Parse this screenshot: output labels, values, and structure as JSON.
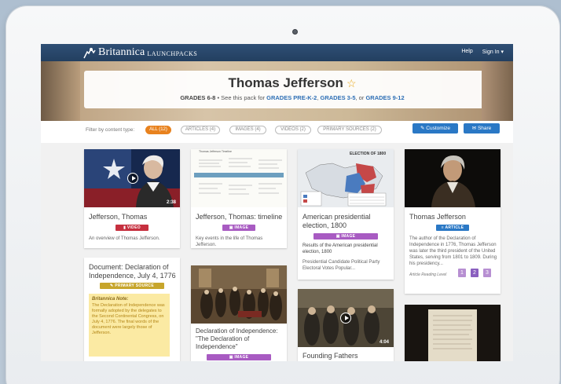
{
  "nav": {
    "brand": "Britannica",
    "brand_sub": "LAUNCHPACKS",
    "help": "Help",
    "sign_in": "Sign In ▾"
  },
  "hero": {
    "title": "Thomas Jefferson",
    "grades_label": "GRADES 6-8",
    "see_text": "• See this pack for",
    "grade_links": [
      "GRADES PRE-K-2",
      "GRADES 3-5",
      "GRADES 9-12"
    ],
    "sep_comma": ",",
    "sep_or": ", or"
  },
  "filters": {
    "label": "Filter by content type:",
    "chips": [
      "ALL (12)",
      "ARTICLES (4)",
      "IMAGES (4)",
      "VIDEOS (2)",
      "PRIMARY SOURCES (2)"
    ],
    "active_index": 0,
    "customize": "Customize",
    "share": "Share"
  },
  "cards": [
    {
      "title": "Jefferson, Thomas",
      "badge": "VIDEO",
      "desc": "An overview of Thomas Jefferson.",
      "duration": "2:38"
    },
    {
      "title": "Jefferson, Thomas: timeline",
      "badge": "IMAGE",
      "desc": "Key events in the life of Thomas Jefferson.",
      "thumb_caption": "Thomas Jefferson Timeline"
    },
    {
      "title": "American presidential election, 1800",
      "badge": "IMAGE",
      "desc": "Results of the American presidential election, 1800",
      "desc2": "Presidential Candidate Political Party Electoral Votes Popular...",
      "thumb_caption": "ELECTION OF 1800"
    },
    {
      "title": "Thomas Jefferson",
      "badge": "ARTICLE",
      "desc": "The author of the Declaration of Independence in 1776, Thomas Jefferson was later the third president of the United States, serving from 1801 to 1809. During his presidency...",
      "reading_level_label": "Article Reading Level",
      "levels": [
        "1",
        "2",
        "3"
      ],
      "selected_level": 1
    },
    {
      "title": "Document: Declaration of Independence, July 4, 1776",
      "badge": "PRIMARY SOURCE",
      "note_title": "Britannica Note:",
      "note_text": "The Declaration of Independence was formally adopted by the delegates to the Second Continental Congress, on July 4, 1776. The final words of the document were largely those of Jefferson."
    },
    {
      "title": "Declaration of Independence: \"The Declaration of Independence\"",
      "badge": "IMAGE"
    },
    {
      "title": "Founding Fathers",
      "duration": "4:04"
    },
    {
      "title": ""
    }
  ],
  "colors": {
    "nav": "#2f4f75",
    "active_chip": "#e8821e",
    "video": "#c6303f",
    "image": "#a85bc2",
    "article": "#2a78c5",
    "primary_source": "#c7a52c"
  }
}
